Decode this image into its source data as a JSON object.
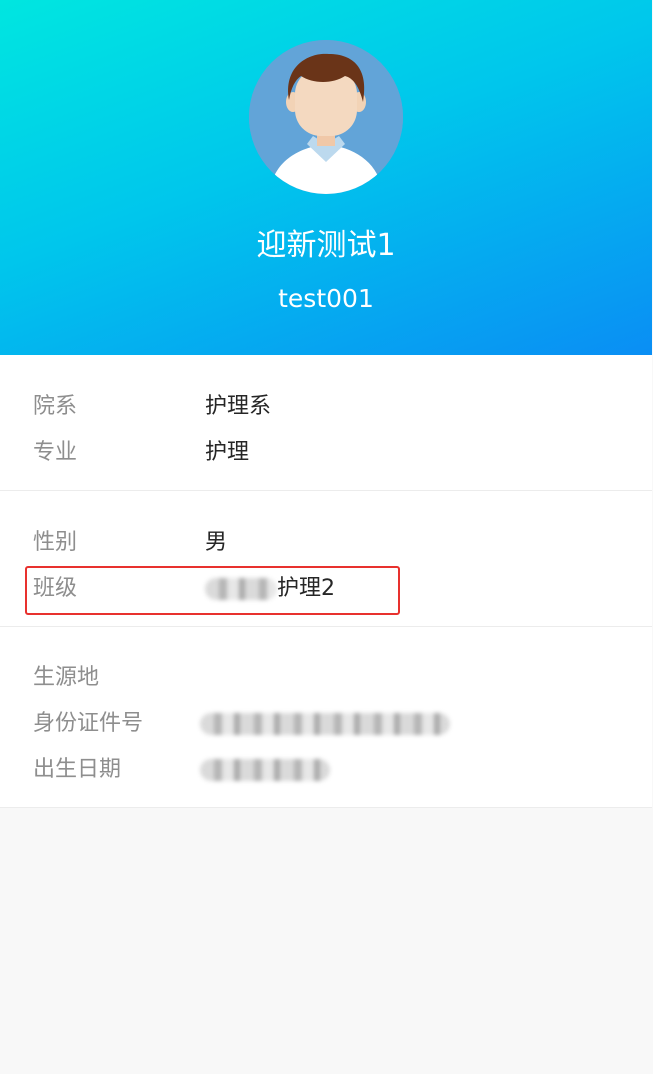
{
  "profile": {
    "name": "迎新测试1",
    "account": "test001"
  },
  "colors": {
    "header_gradient_start": "#00e6e0",
    "header_gradient_end": "#0a8ef4",
    "highlight": "#e8312e"
  },
  "sections": {
    "academic": {
      "department_label": "院系",
      "department_value": "护理系",
      "major_label": "专业",
      "major_value": "护理"
    },
    "personal": {
      "gender_label": "性别",
      "gender_value": "男",
      "class_label": "班级",
      "class_value_visible": "护理2"
    },
    "identity": {
      "origin_label": "生源地",
      "origin_value": "",
      "id_label": "身份证件号",
      "birth_label": "出生日期"
    }
  },
  "icons": {
    "avatar": "male-avatar-icon"
  }
}
